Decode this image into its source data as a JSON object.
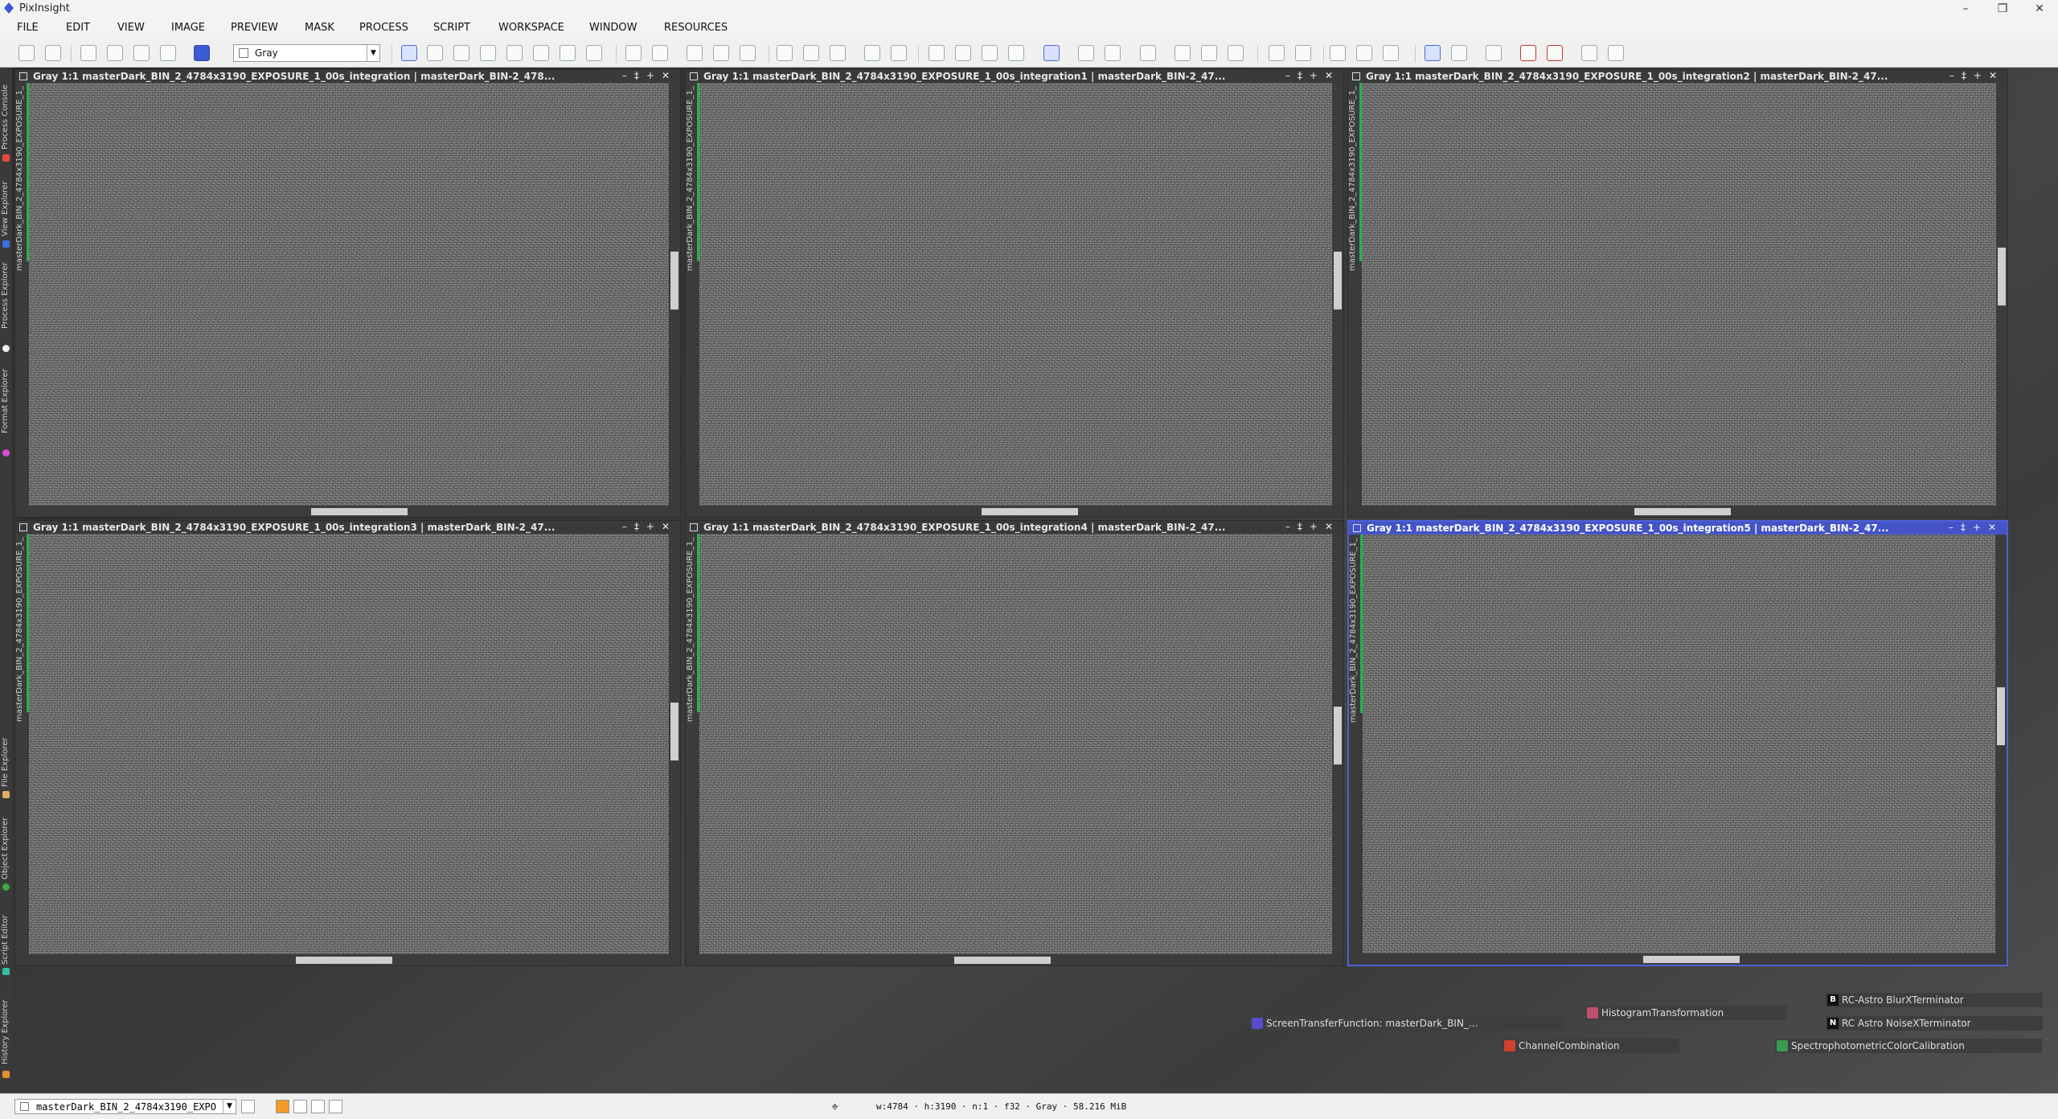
{
  "app": {
    "title": "PixInsight",
    "window_controls": [
      "–",
      "❐",
      "✕"
    ]
  },
  "menu": [
    "FILE",
    "EDIT",
    "VIEW",
    "IMAGE",
    "PREVIEW",
    "MASK",
    "PROCESS",
    "SCRIPT",
    "WORKSPACE",
    "WINDOW",
    "RESOURCES"
  ],
  "toolbar": {
    "color_space": "Gray"
  },
  "left_dock": [
    "Process Console",
    "View Explorer",
    "Process Explorer",
    "Format Explorer",
    "File Explorer",
    "Object Explorer",
    "Script Editor",
    "History Explorer"
  ],
  "windows": [
    {
      "title": "Gray 1:1 masterDark_BIN_2_4784x3190_EXPOSURE_1_00s_integration | masterDark_BIN-2_478...",
      "id": "masterDark_BIN_2_4784x3190_EXPOSURE_1_00s_integration",
      "active": false
    },
    {
      "title": "Gray 1:1 masterDark_BIN_2_4784x3190_EXPOSURE_1_00s_integration1 | masterDark_BIN-2_47...",
      "id": "masterDark_BIN_2_4784x3190_EXPOSURE_1_00s_integration1",
      "active": false
    },
    {
      "title": "Gray 1:1 masterDark_BIN_2_4784x3190_EXPOSURE_1_00s_integration2 | masterDark_BIN-2_47...",
      "id": "masterDark_BIN_2_4784x3190_EXPOSURE_1_00s_integration2",
      "active": false
    },
    {
      "title": "Gray 1:1 masterDark_BIN_2_4784x3190_EXPOSURE_1_00s_integration3 | masterDark_BIN-2_47...",
      "id": "masterDark_BIN_2_4784x3190_EXPOSURE_1_00s_integration3",
      "active": false
    },
    {
      "title": "Gray 1:1 masterDark_BIN_2_4784x3190_EXPOSURE_1_00s_integration4 | masterDark_BIN-2_47...",
      "id": "masterDark_BIN_2_4784x3190_EXPOSURE_1_00s_integration4",
      "active": false
    },
    {
      "title": "Gray 1:1 masterDark_BIN_2_4784x3190_EXPOSURE_1_00s_integration5 | masterDark_BIN-2_47...",
      "id": "masterDark_BIN_2_4784x3190_EXPOSURE_1_00s_integration5",
      "active": true
    }
  ],
  "process_icons": [
    {
      "label": "RC-Astro BlurXTerminator",
      "letter": "B"
    },
    {
      "label": "RC Astro NoiseXTerminator",
      "letter": "N"
    },
    {
      "label": "HistogramTransformation",
      "color": "#c05070"
    },
    {
      "label": "ScreenTransferFunction: masterDark_BIN_...",
      "color": "#5a4bd0"
    },
    {
      "label": "ChannelCombination",
      "color": "#d04030"
    },
    {
      "label": "SpectrophotometricColorCalibration",
      "color": "#3a9a50"
    }
  ],
  "statusbar": {
    "view": "masterDark_BIN_2_4784x3190_EXPO",
    "info": "w:4784 · h:3190 · n:1 · f32 · Gray · 58.216 MiB"
  },
  "colors": {
    "active_window": "#4454c6",
    "view_id_bar": "#23b24b"
  }
}
